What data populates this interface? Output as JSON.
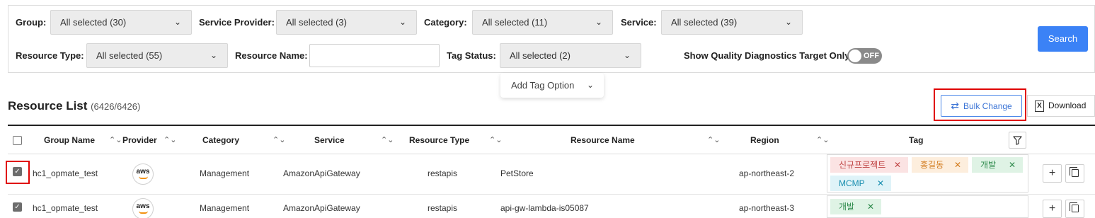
{
  "filters": {
    "group": {
      "label": "Group:",
      "value": "All selected (30)"
    },
    "service_provider": {
      "label": "Service Provider:",
      "value": "All selected (3)"
    },
    "category": {
      "label": "Category:",
      "value": "All selected (11)"
    },
    "service": {
      "label": "Service:",
      "value": "All selected (39)"
    },
    "resource_type": {
      "label": "Resource Type:",
      "value": "All selected (55)"
    },
    "resource_name": {
      "label": "Resource Name:",
      "value": ""
    },
    "tag_status": {
      "label": "Tag Status:",
      "value": "All selected (2)"
    },
    "quality_diag": {
      "label": "Show Quality Diagnostics Target Only:",
      "toggle": "OFF"
    },
    "search_label": "Search",
    "add_tag_option": "Add Tag Option"
  },
  "list": {
    "title": "Resource List",
    "count": "(6426/6426)",
    "bulk_change": "Bulk Change",
    "download": "Download"
  },
  "table": {
    "headers": {
      "group_name": "Group Name",
      "provider": "Provider",
      "category": "Category",
      "service": "Service",
      "resource_type": "Resource Type",
      "resource_name": "Resource Name",
      "region": "Region",
      "tag": "Tag"
    },
    "rows": [
      {
        "group_name": "hc1_opmate_test",
        "provider_logo": "aws",
        "category": "Management",
        "service": "AmazonApiGateway",
        "resource_type": "restapis",
        "resource_name": "PetStore",
        "region": "ap-northeast-2",
        "checked": true,
        "tags": [
          "신규프로젝트",
          "홍길동",
          "개발",
          "MCMP"
        ]
      },
      {
        "group_name": "hc1_opmate_test",
        "provider_logo": "aws",
        "category": "Management",
        "service": "AmazonApiGateway",
        "resource_type": "restapis",
        "resource_name": "api-gw-lambda-is05087",
        "region": "ap-northeast-3",
        "checked": true,
        "tags": [
          "개발"
        ]
      }
    ]
  },
  "glyphs": {
    "chevron": "⌄",
    "sort": "⌃⌄",
    "close": "✕",
    "check": "✓",
    "plus": "+",
    "swap": "⇄",
    "excel": "X"
  },
  "colors": {
    "primary": "#3b82f6",
    "highlight": "#e00000"
  }
}
